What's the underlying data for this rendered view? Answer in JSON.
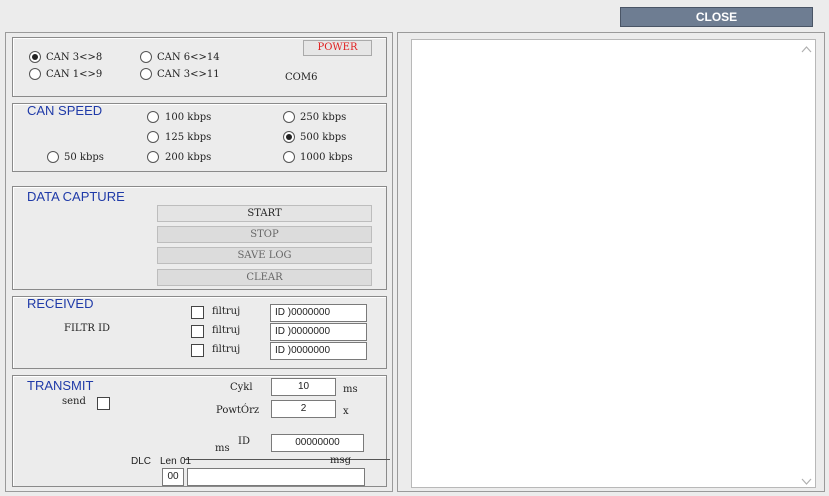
{
  "window": {
    "close_label": "CLOSE"
  },
  "port": {
    "radios": [
      {
        "label": "CAN 3<>8",
        "selected": true
      },
      {
        "label": "CAN 6<>14",
        "selected": false
      },
      {
        "label": "CAN 1<>9",
        "selected": false
      },
      {
        "label": "CAN 3<>11",
        "selected": false
      }
    ],
    "power_label": "POWER",
    "power_color": "#e02020",
    "com_label": "COM6"
  },
  "can_speed": {
    "title": "CAN SPEED",
    "options": [
      {
        "label": "100 kbps",
        "selected": false
      },
      {
        "label": "250 kbps",
        "selected": false
      },
      {
        "label": "125 kbps",
        "selected": false
      },
      {
        "label": "500 kbps",
        "selected": true
      },
      {
        "label": "50 kbps",
        "selected": false
      },
      {
        "label": "200 kbps",
        "selected": false
      },
      {
        "label": "1000 kbps",
        "selected": false
      }
    ]
  },
  "data_capture": {
    "title": "DATA CAPTURE",
    "start_label": "START",
    "stop_label": "STOP",
    "save_log_label": "SAVE LOG",
    "clear_label": "CLEAR"
  },
  "received": {
    "title": "RECEIVED",
    "filter_id_label": "FILTR ID",
    "filters": [
      {
        "label": "filtruj",
        "id_label": "ID",
        "value": ")0000000",
        "checked": false
      },
      {
        "label": "filtruj",
        "id_label": "ID",
        "value": ")0000000",
        "checked": false
      },
      {
        "label": "filtruj",
        "id_label": "ID",
        "value": ")0000000",
        "checked": false
      }
    ]
  },
  "transmit": {
    "title": "TRANSMIT",
    "send_label": "send",
    "send_checked": false,
    "cykl_label": "Cykl",
    "cykl_value": "10",
    "cykl_unit": "ms",
    "powtorz_label": "PowtÓrz",
    "powtorz_value": "2",
    "powtorz_unit": "x",
    "ms_label": "ms",
    "id_label": "ID",
    "id_value": "00000000",
    "dlc_label": "DLC",
    "len_label": "Len",
    "len_value_label": "01",
    "msg_label": "msg",
    "dlc_value": "00",
    "msg_value": ""
  },
  "log": {
    "content": ""
  }
}
